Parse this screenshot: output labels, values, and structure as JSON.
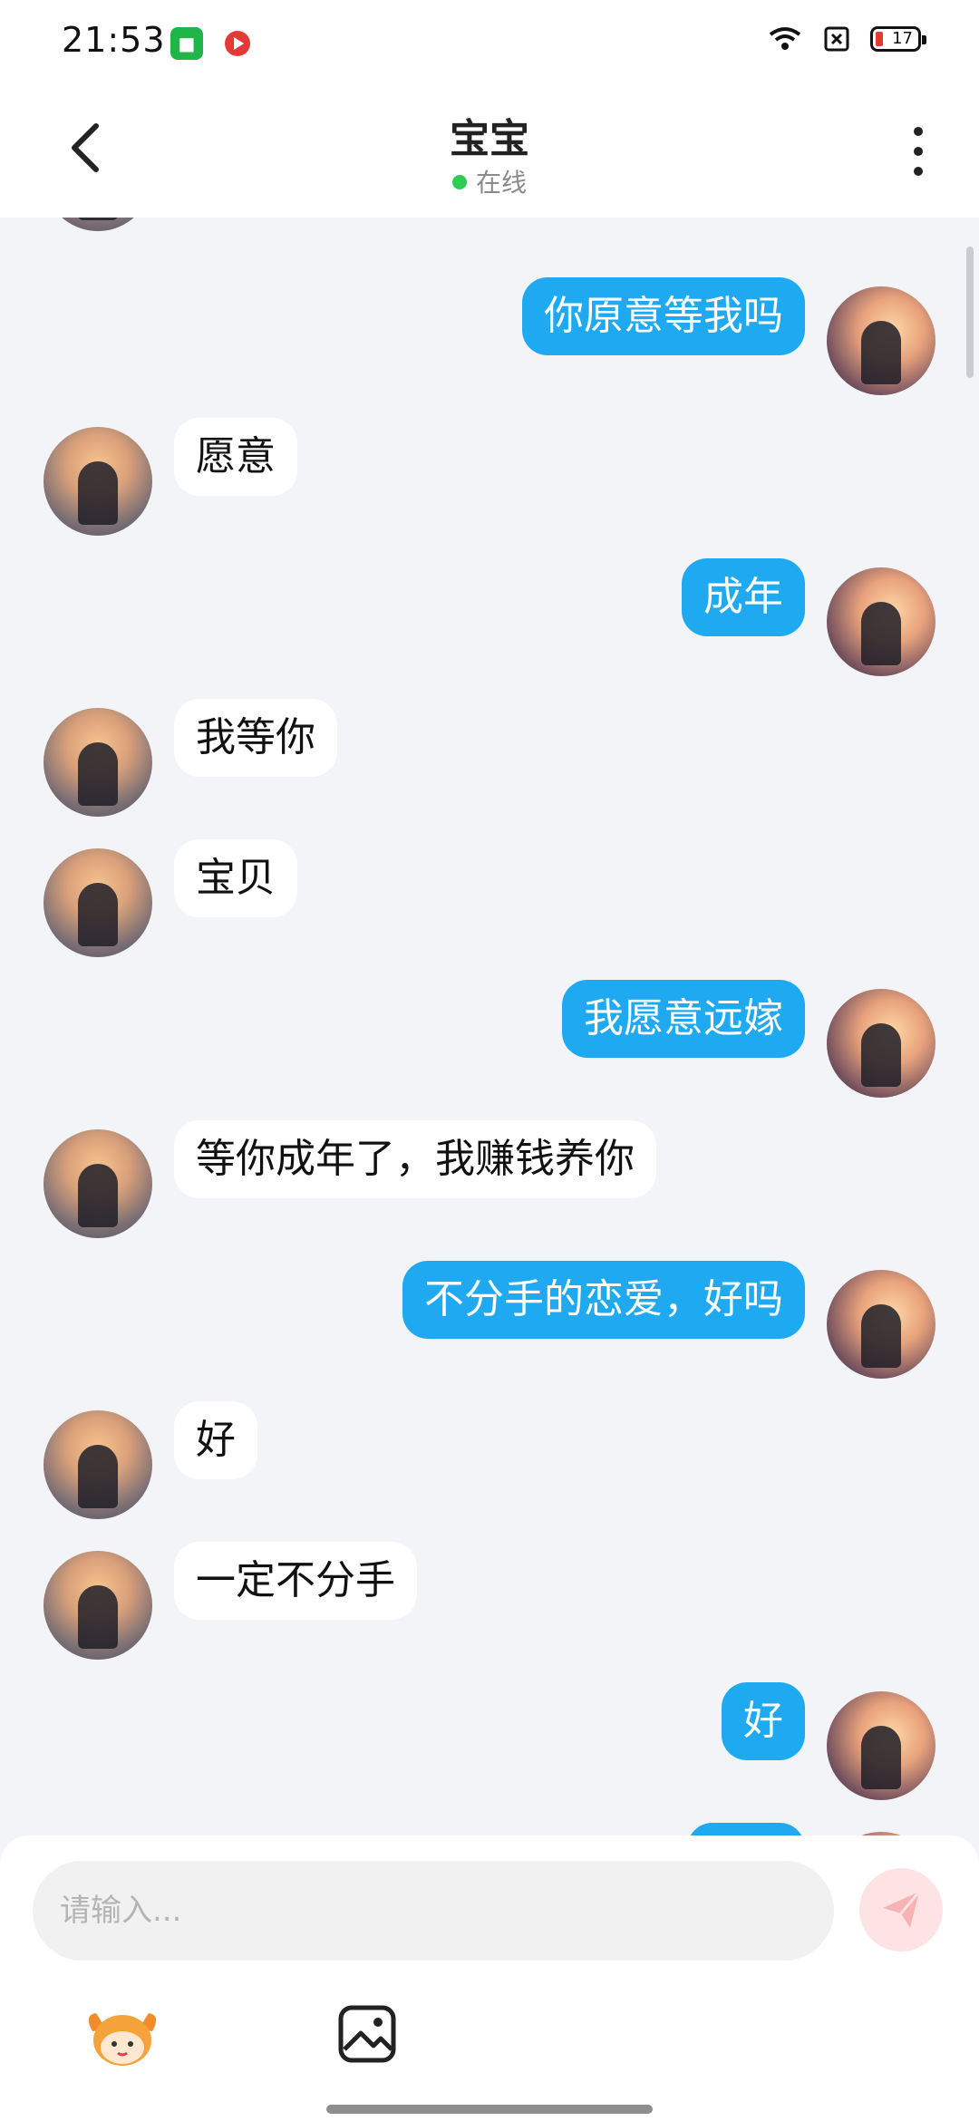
{
  "status_bar": {
    "time": "21:53",
    "battery": "17"
  },
  "header": {
    "title": "宝宝",
    "presence": "在线"
  },
  "messages": [
    {
      "from": "self",
      "text": "你原意等我吗"
    },
    {
      "from": "other",
      "text": "愿意"
    },
    {
      "from": "self",
      "text": "成年"
    },
    {
      "from": "other",
      "text": "我等你"
    },
    {
      "from": "other",
      "text": "宝贝"
    },
    {
      "from": "self",
      "text": "我愿意远嫁"
    },
    {
      "from": "other",
      "text": "等你成年了，我赚钱养你"
    },
    {
      "from": "self",
      "text": "不分手的恋爱，好吗"
    },
    {
      "from": "other",
      "text": "好"
    },
    {
      "from": "other",
      "text": "一定不分手"
    },
    {
      "from": "self",
      "text": "好"
    }
  ],
  "composer": {
    "placeholder": "请输入..."
  },
  "colors": {
    "self_bubble": "#1fa9f0",
    "other_bubble": "#ffffff",
    "background": "#f2f4f8",
    "online_dot": "#2ecc52"
  }
}
